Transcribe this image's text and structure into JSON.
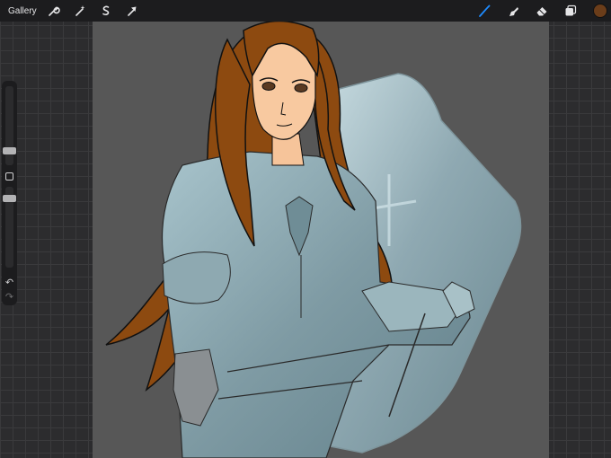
{
  "toolbar": {
    "gallery_label": "Gallery",
    "left_tools": [
      "wrench-icon",
      "magic-wand-icon",
      "selection-icon",
      "transform-arrow-icon"
    ],
    "right_tools": [
      "brush-icon",
      "smudge-icon",
      "eraser-icon",
      "layers-icon"
    ],
    "active_tool": "brush",
    "active_tool_color": "#1e8bff",
    "current_color": "#6b3d1a"
  },
  "sidebar": {
    "brush_size": 0.2,
    "opacity": 0.2,
    "undo_icon": "↶",
    "redo_icon": "↷"
  }
}
